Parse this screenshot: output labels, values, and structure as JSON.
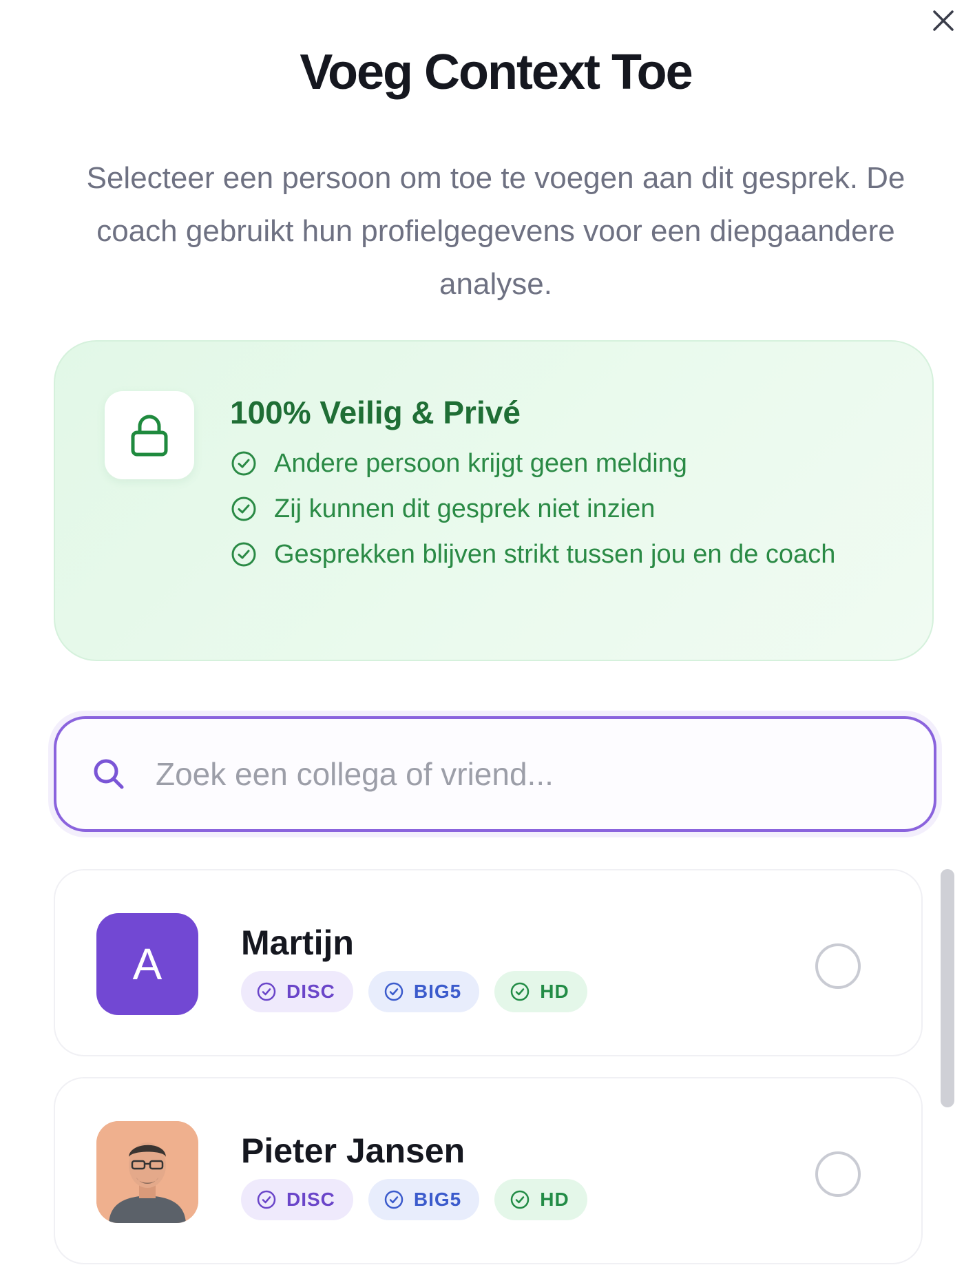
{
  "dialog": {
    "title": "Voeg Context Toe",
    "subtitle": "Selecteer een persoon om toe te voegen aan dit gesprek. De coach gebruikt hun profielgegevens voor een diepgaandere analyse.",
    "close_icon": "close-icon"
  },
  "privacy": {
    "icon": "lock-icon",
    "title": "100% Veilig & Privé",
    "items": [
      "Andere persoon krijgt geen melding",
      "Zij kunnen dit gesprek niet inzien",
      "Gesprekken blijven strikt tussen jou en de coach"
    ],
    "colors": {
      "background": "#e2f8e7",
      "title": "#1f6e35",
      "text": "#2a8a45"
    }
  },
  "search": {
    "icon": "search-icon",
    "placeholder": "Zoek een collega of vriend...",
    "value": "",
    "border_color": "#8a63dd"
  },
  "people": [
    {
      "name": "Martijn",
      "avatar_letter": "A",
      "avatar_color": "#7248d3",
      "badges": [
        "DISC",
        "BIG5",
        "HD"
      ],
      "selected": false
    },
    {
      "name": "Pieter Jansen",
      "avatar": "person-photo",
      "badges": [
        "DISC",
        "BIG5",
        "HD"
      ],
      "selected": false
    }
  ],
  "badge_colors": {
    "DISC": "#6a45c9",
    "BIG5": "#3b5bcc",
    "HD": "#228c46"
  }
}
